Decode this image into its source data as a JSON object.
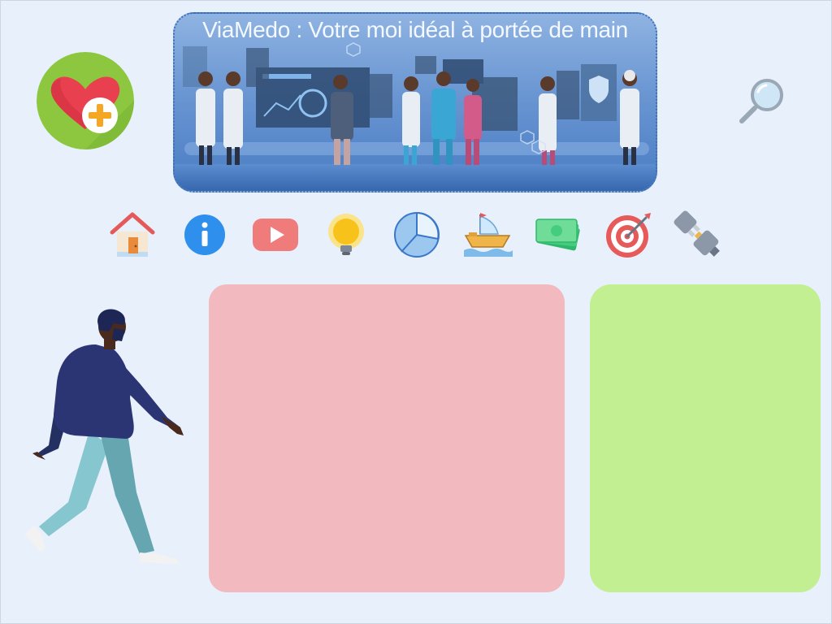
{
  "header": {
    "title": "ViaMedo : Votre moi idéal à portée de main",
    "logo_icon": "heart-plus-icon",
    "search_icon": "magnifier-icon"
  },
  "nav": {
    "items": [
      {
        "id": "home",
        "icon": "house-icon"
      },
      {
        "id": "info",
        "icon": "info-icon"
      },
      {
        "id": "video",
        "icon": "youtube-play-icon"
      },
      {
        "id": "ideas",
        "icon": "lightbulb-icon"
      },
      {
        "id": "stats",
        "icon": "pie-chart-icon"
      },
      {
        "id": "journey",
        "icon": "ship-icon"
      },
      {
        "id": "money",
        "icon": "banknotes-icon"
      },
      {
        "id": "goals",
        "icon": "target-icon"
      },
      {
        "id": "connect",
        "icon": "plug-icon"
      }
    ]
  },
  "colors": {
    "background": "#e8f0fc",
    "panel_left": "#f2b9bf",
    "panel_right": "#c2ef91",
    "logo_circle": "#8dc63f",
    "heart": "#e8404e",
    "plus": "#f5a623"
  }
}
